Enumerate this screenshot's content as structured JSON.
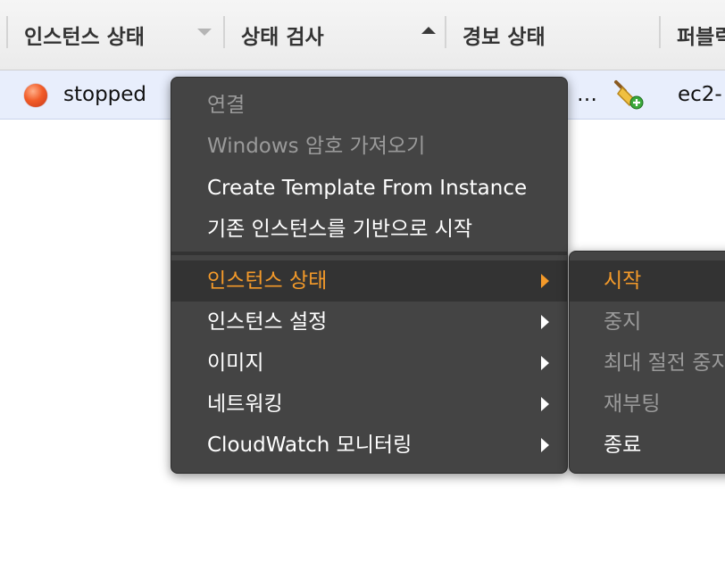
{
  "table": {
    "columns": [
      {
        "label": "인스턴스 상태",
        "sort": "none"
      },
      {
        "label": "상태 검사",
        "sort": "ascending"
      },
      {
        "label": "경보 상태",
        "sort": "none"
      },
      {
        "label": "퍼블릭 DNS",
        "sort": "none"
      }
    ],
    "row": {
      "state": "stopped",
      "ellipsis": "…",
      "dns": "ec2-"
    }
  },
  "context_menu": {
    "items": [
      {
        "label": "연결",
        "disabled": true
      },
      {
        "label": "Windows 암호 가져오기",
        "disabled": true
      },
      {
        "label": "Create Template From Instance",
        "disabled": false
      },
      {
        "label": "기존 인스턴스를 기반으로 시작",
        "disabled": false
      },
      {
        "label": "인스턴스 상태",
        "has_submenu": true,
        "active": true
      },
      {
        "label": "인스턴스 설정",
        "has_submenu": true
      },
      {
        "label": "이미지",
        "has_submenu": true
      },
      {
        "label": "네트워킹",
        "has_submenu": true
      },
      {
        "label": "CloudWatch 모니터링",
        "has_submenu": true
      }
    ]
  },
  "submenu": {
    "items": [
      {
        "label": "시작",
        "active": true
      },
      {
        "label": "중지",
        "disabled": true
      },
      {
        "label": "최대 절전 중지",
        "disabled": true
      },
      {
        "label": "재부팅",
        "disabled": true
      },
      {
        "label": "종료",
        "disabled": false
      }
    ]
  },
  "colors": {
    "menu_bg": "#444444",
    "highlight_text": "#f49a2a",
    "disabled_text": "#9a9a9a",
    "row_selected": "#e8eefc",
    "status_stopped": "#e94d22"
  }
}
